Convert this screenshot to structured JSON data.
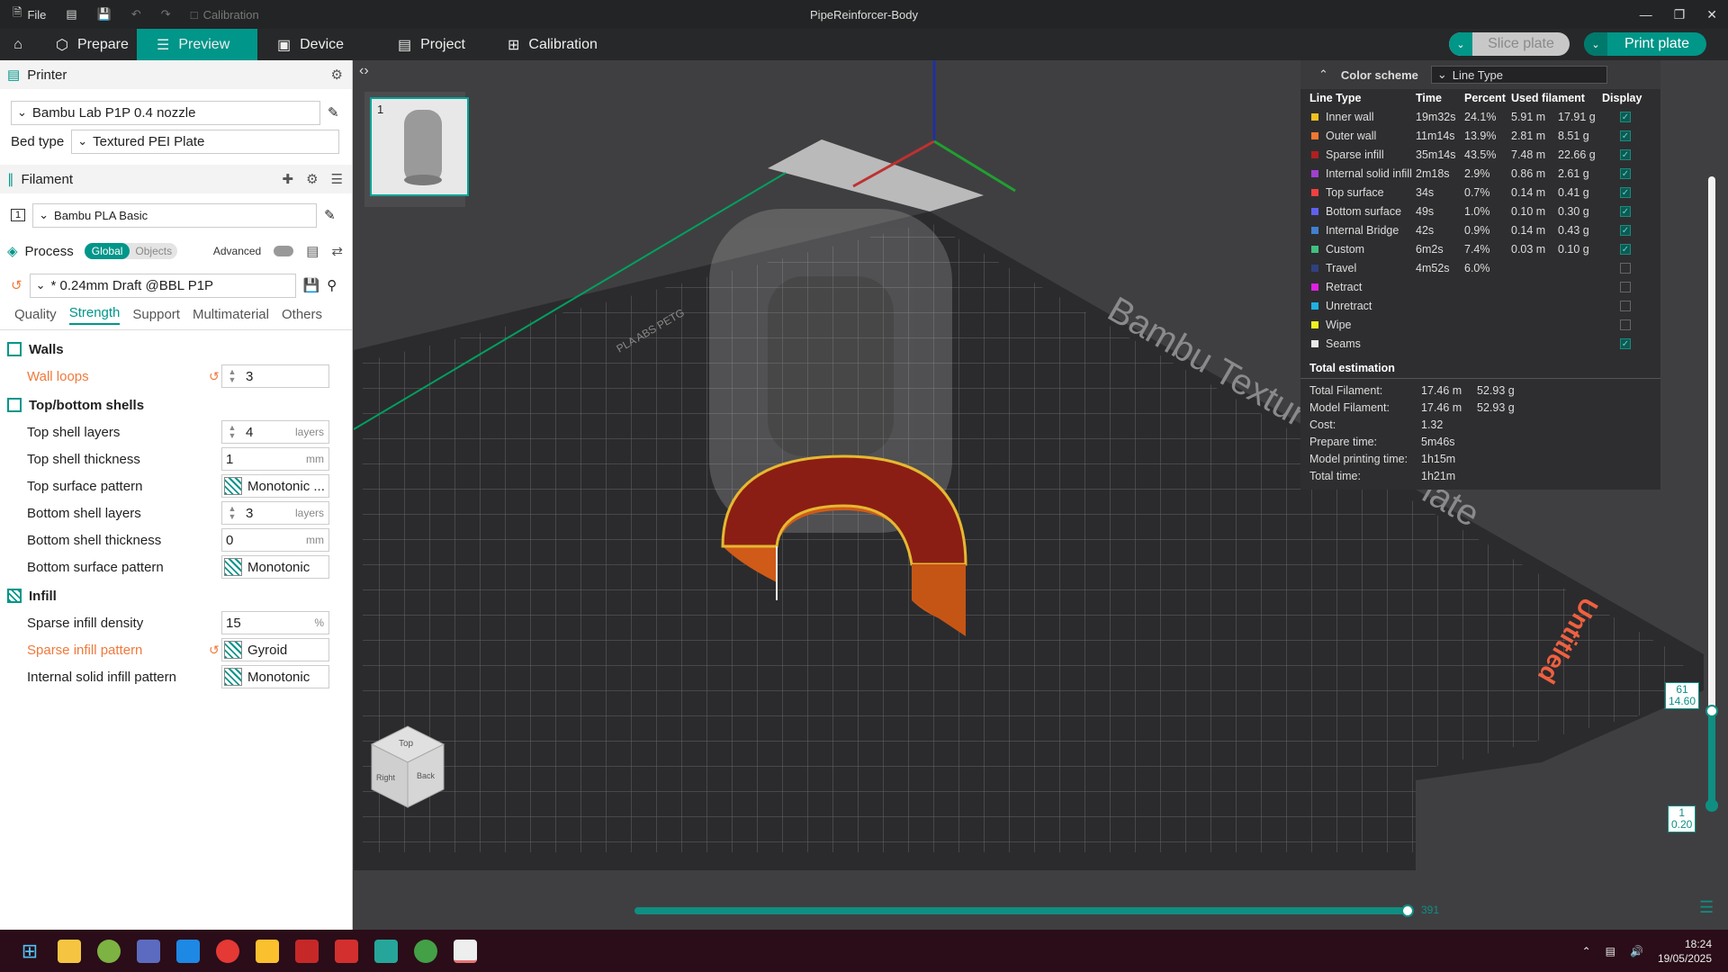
{
  "titlebar": {
    "file": "File",
    "calibration": "Calibration",
    "title": "PipeReinforcer-Body"
  },
  "menubar": {
    "tabs": [
      "Prepare",
      "Preview",
      "Device",
      "Project",
      "Calibration"
    ],
    "active": "Preview",
    "slice": "Slice plate",
    "print": "Print plate"
  },
  "printer": {
    "header": "Printer",
    "name": "Bambu Lab P1P 0.4 nozzle",
    "bed_label": "Bed type",
    "bed_value": "Textured PEI Plate"
  },
  "filament": {
    "header": "Filament",
    "index": "1",
    "name": "Bambu PLA Basic"
  },
  "process": {
    "header": "Process",
    "global": "Global",
    "objects": "Objects",
    "advanced": "Advanced",
    "preset": "* 0.24mm Draft @BBL P1P",
    "tabs": [
      "Quality",
      "Strength",
      "Support",
      "Multimaterial",
      "Others"
    ],
    "active_tab": "Strength"
  },
  "walls": {
    "title": "Walls",
    "wall_loops": {
      "label": "Wall loops",
      "value": "3"
    }
  },
  "shells": {
    "title": "Top/bottom shells",
    "top_layers": {
      "label": "Top shell layers",
      "value": "4",
      "unit": "layers"
    },
    "top_thickness": {
      "label": "Top shell thickness",
      "value": "1",
      "unit": "mm"
    },
    "top_pattern": {
      "label": "Top surface pattern",
      "value": "Monotonic ..."
    },
    "bottom_layers": {
      "label": "Bottom shell layers",
      "value": "3",
      "unit": "layers"
    },
    "bottom_thickness": {
      "label": "Bottom shell thickness",
      "value": "0",
      "unit": "mm"
    },
    "bottom_pattern": {
      "label": "Bottom surface pattern",
      "value": "Monotonic"
    }
  },
  "infill": {
    "title": "Infill",
    "density": {
      "label": "Sparse infill density",
      "value": "15",
      "unit": "%"
    },
    "pattern": {
      "label": "Sparse infill pattern",
      "value": "Gyroid"
    },
    "internal": {
      "label": "Internal solid infill pattern",
      "value": "Monotonic"
    }
  },
  "viewport": {
    "plate_number": "1",
    "plate_text": "Bambu Textured PEI Plate",
    "plate_side": "PLA ABS PETG",
    "untitled": "Untitled",
    "cube_top": "Top",
    "cube_right": "Right",
    "cube_back": "Back"
  },
  "stats": {
    "color_scheme": "Color scheme",
    "scheme_value": "Line Type",
    "headers": [
      "Line Type",
      "Time",
      "Percent",
      "Used filament",
      "Display"
    ],
    "rows": [
      {
        "name": "Inner wall",
        "color": "#f0c020",
        "time": "19m32s",
        "pct": "24.1%",
        "m": "5.91 m",
        "g": "17.91 g",
        "on": true
      },
      {
        "name": "Outer wall",
        "color": "#f07830",
        "time": "11m14s",
        "pct": "13.9%",
        "m": "2.81 m",
        "g": "8.51 g",
        "on": true
      },
      {
        "name": "Sparse infill",
        "color": "#b02020",
        "time": "35m14s",
        "pct": "43.5%",
        "m": "7.48 m",
        "g": "22.66 g",
        "on": true
      },
      {
        "name": "Internal solid infill",
        "color": "#a040d0",
        "time": "2m18s",
        "pct": "2.9%",
        "m": "0.86 m",
        "g": "2.61 g",
        "on": true
      },
      {
        "name": "Top surface",
        "color": "#f04040",
        "time": "34s",
        "pct": "0.7%",
        "m": "0.14 m",
        "g": "0.41 g",
        "on": true
      },
      {
        "name": "Bottom surface",
        "color": "#6060f0",
        "time": "49s",
        "pct": "1.0%",
        "m": "0.10 m",
        "g": "0.30 g",
        "on": true
      },
      {
        "name": "Internal Bridge",
        "color": "#4080d0",
        "time": "42s",
        "pct": "0.9%",
        "m": "0.14 m",
        "g": "0.43 g",
        "on": true
      },
      {
        "name": "Custom",
        "color": "#40c080",
        "time": "6m2s",
        "pct": "7.4%",
        "m": "0.03 m",
        "g": "0.10 g",
        "on": true
      },
      {
        "name": "Travel",
        "color": "#304080",
        "time": "4m52s",
        "pct": "6.0%",
        "m": "",
        "g": "",
        "on": false
      },
      {
        "name": "Retract",
        "color": "#e020e0",
        "time": "",
        "pct": "",
        "m": "",
        "g": "",
        "on": false
      },
      {
        "name": "Unretract",
        "color": "#20b0e0",
        "time": "",
        "pct": "",
        "m": "",
        "g": "",
        "on": false
      },
      {
        "name": "Wipe",
        "color": "#f0f020",
        "time": "",
        "pct": "",
        "m": "",
        "g": "",
        "on": false
      },
      {
        "name": "Seams",
        "color": "#e8e8e8",
        "time": "",
        "pct": "",
        "m": "",
        "g": "",
        "on": true
      }
    ],
    "total_title": "Total estimation",
    "totals": [
      {
        "k": "Total Filament:",
        "v1": "17.46 m",
        "v2": "52.93 g"
      },
      {
        "k": "Model Filament:",
        "v1": "17.46 m",
        "v2": "52.93 g"
      },
      {
        "k": "Cost:",
        "v1": "1.32",
        "v2": ""
      },
      {
        "k": "Prepare time:",
        "v1": "5m46s",
        "v2": ""
      },
      {
        "k": "Model printing time:",
        "v1": "1h15m",
        "v2": ""
      },
      {
        "k": "Total time:",
        "v1": "1h21m",
        "v2": ""
      }
    ]
  },
  "layers": {
    "h_value": "391",
    "top_layer": "61",
    "top_height": "14.60",
    "bottom_layer": "1",
    "bottom_height": "0.20"
  },
  "taskbar": {
    "time": "18:24",
    "date": "19/05/2025"
  }
}
